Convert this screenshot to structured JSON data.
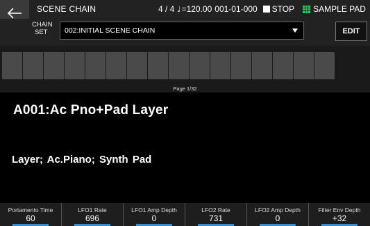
{
  "header": {
    "title": "SCENE CHAIN",
    "time_signature": "4 / 4",
    "tempo": "=120.00",
    "position": "001-01-000",
    "transport": "STOP",
    "sample_pad": "SAMPLE PAD"
  },
  "chain_set": {
    "label_line1": "CHAIN",
    "label_line2": "SET",
    "value": "002:INITIAL SCENE CHAIN",
    "edit_label": "EDIT"
  },
  "pads": {
    "count": 16,
    "page": "Page  1/32"
  },
  "scene": {
    "name": "A001:Ac Pno+Pad Layer",
    "tags": "Layer;  Ac.Piano;  Synth Pad"
  },
  "params": [
    {
      "label": "Portamento Time",
      "value": "60"
    },
    {
      "label": "LFO1 Rate",
      "value": "696"
    },
    {
      "label": "LFO1 Amp Depth",
      "value": "0"
    },
    {
      "label": "LFO2 Rate",
      "value": "731"
    },
    {
      "label": "LFO2 Amp Depth",
      "value": "0"
    },
    {
      "label": "Filter Env Depth",
      "value": "+32"
    }
  ]
}
